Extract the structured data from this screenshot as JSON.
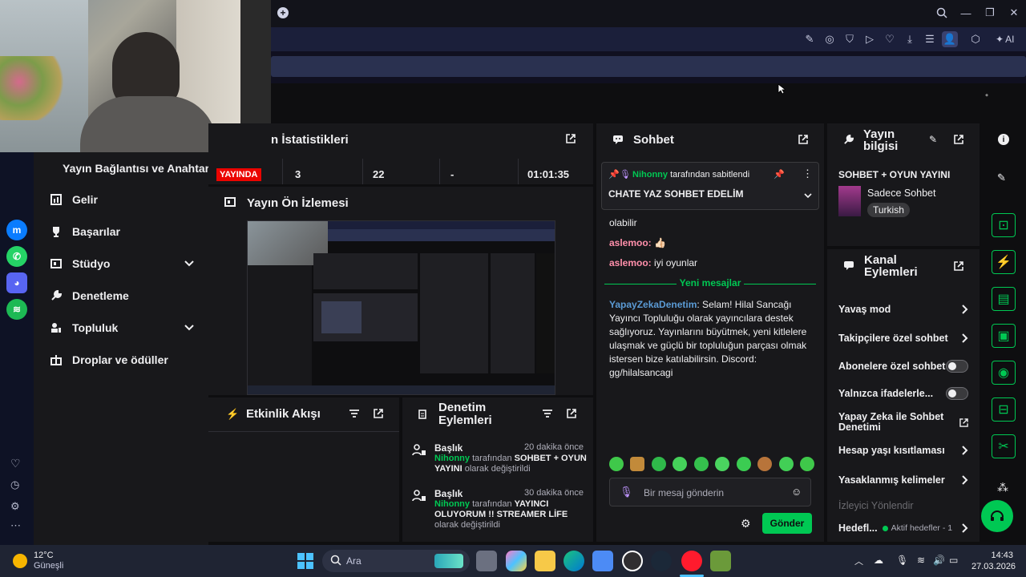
{
  "browser": {
    "ai_label": "AI",
    "new_tab_icon": "plus-icon"
  },
  "sidebar": {
    "header": "Yayın Bağlantısı ve Anahtarı",
    "items": [
      {
        "label": "Gelir",
        "icon": "chart-icon"
      },
      {
        "label": "Başarılar",
        "icon": "trophy-icon"
      },
      {
        "label": "Stüdyo",
        "icon": "studio-icon"
      },
      {
        "label": "Denetleme",
        "icon": "wrench-icon"
      },
      {
        "label": "Topluluk",
        "icon": "community-icon"
      },
      {
        "label": "Droplar ve ödüller",
        "icon": "gift-icon"
      }
    ]
  },
  "stats": {
    "title": "n İstatistikleri",
    "live_badge": "YAYINDA",
    "values": [
      "3",
      "22",
      "-",
      "01:01:35"
    ]
  },
  "preview": {
    "title": "Yayın Ön İzlemesi"
  },
  "activity": {
    "title": "Etkinlik Akışı"
  },
  "moderation": {
    "title_line1": "Denetim",
    "title_line2": "Eylemleri",
    "entries": [
      {
        "heading": "Başlık",
        "time": "20 dakika önce",
        "user": "Nihonny",
        "mid": "tarafından",
        "text": "SOHBET + OYUN YAYINI",
        "suffix": "olarak değiştirildi"
      },
      {
        "heading": "Başlık",
        "time": "30 dakika önce",
        "user": "Nihonny",
        "mid": "tarafından",
        "text": "YAYINCI OLUYORUM !! STREAMER LİFE",
        "suffix": "olarak değiştirildi"
      }
    ]
  },
  "chat": {
    "title": "Sohbet",
    "pinned_by_user": "Nihonny",
    "pinned_by_suffix": "tarafından sabitlendi",
    "pinned_message": "CHATE YAZ SOHBET EDELİM",
    "partial_line": "olabilir",
    "messages": [
      {
        "user": "aslemoo:",
        "text": "👍🏻"
      },
      {
        "user": "aslemoo:",
        "text": "iyi oyunlar"
      }
    ],
    "new_messages_label": "Yeni mesajlar",
    "bot_user": "YapayZekaDenetim",
    "bot_text": ": Selam! Hilal Sancağı Yayıncı Topluluğu olarak yayıncılara destek sağlıyoruz. Yayınlarını büyütmek, yeni kitlelere ulaşmak ve güçlü bir topluluğun parçası olmak istersen bize katılabilirsin. Discord: gg/hilalsancagi",
    "input_placeholder": "Bir mesaj gönderin",
    "send_label": "Gönder"
  },
  "stream_info": {
    "title_line1": "Yayın",
    "title_line2": "bilgisi",
    "stream_title": "SOHBET + OYUN YAYINI",
    "category": "Sadece Sohbet",
    "language_tag": "Turkish"
  },
  "channel_actions": {
    "title_line1": "Kanal",
    "title_line2": "Eylemleri",
    "rows": [
      {
        "label": "Yavaş mod",
        "control": "chevron"
      },
      {
        "label": "Takipçilere özel sohbet",
        "control": "chevron"
      },
      {
        "label": "Abonelere özel sohbet",
        "control": "toggle"
      },
      {
        "label": "Yalnızca ifadelerle...",
        "control": "toggle"
      },
      {
        "label": "Yapay Zeka ile Sohbet Denetimi",
        "control": "external"
      },
      {
        "label": "Hesap yaşı kısıtlaması",
        "control": "chevron"
      },
      {
        "label": "Yasaklanmış kelimeler",
        "control": "chevron"
      }
    ],
    "raid_label": "İzleyici Yönlendir",
    "goals_label": "Hedefl...",
    "goals_status": "Aktif hedefler - 1"
  },
  "taskbar": {
    "weather_temp": "12°C",
    "weather_desc": "Güneşli",
    "search_label": "Ara",
    "time": "14:43",
    "date": "27.03.2026"
  },
  "colors": {
    "accent_green": "#00c853",
    "live_red": "#eb0400",
    "send_green": "#00c853"
  }
}
